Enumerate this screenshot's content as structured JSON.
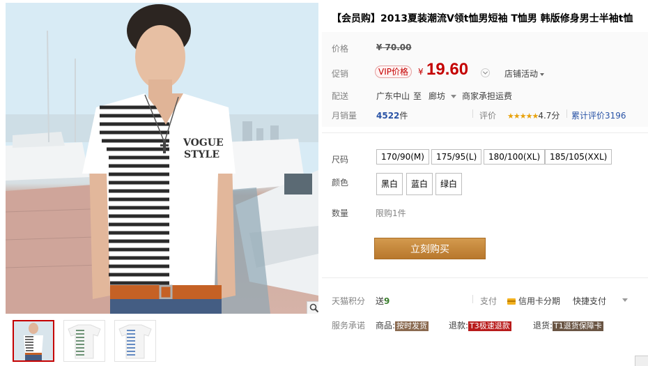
{
  "product": {
    "title": "【会员购】2013夏装潮流V领t恤男短袖 T恤男 韩版修身男士半袖t恤",
    "shirt_print": {
      "line1": "VOGUE",
      "line2": "STYLE"
    }
  },
  "meta": {
    "original_price_label": "价格",
    "original_price": "¥ 70.00",
    "promo_label": "促销",
    "vip_badge": "VIP价格",
    "currency": "¥",
    "price": "19.60",
    "shop_activity": "店铺活动",
    "shipping_label": "配送",
    "ship_from": "广东中山",
    "ship_to_word": "至",
    "ship_dest": "廊坊",
    "shipping_note": "商家承担运费",
    "monthly_sales_label": "月销量",
    "monthly_sales_value": "4522",
    "monthly_sales_unit": "件",
    "rating_label": "评价",
    "rating_stars": "★★★★★",
    "rating_score": "4.7分",
    "total_reviews_label": "累计评价",
    "total_reviews": "3196"
  },
  "options": {
    "size_label": "尺码",
    "sizes": [
      "170/90(M)",
      "175/95(L)",
      "180/100(XL)",
      "185/105(XXL)"
    ],
    "color_label": "颜色",
    "colors": [
      "黑白",
      "蓝白",
      "绿白"
    ],
    "quantity_label": "数量",
    "quantity_limit": "限购1件"
  },
  "actions": {
    "buy_now": "立刻购买"
  },
  "extra": {
    "points_label": "天猫积分",
    "points_prefix": "送",
    "points_value": "9",
    "payment_label": "支付",
    "credit_installment": "信用卡分期",
    "quick_pay": "快捷支付",
    "service_label": "服务承诺",
    "goods_label": "商品:",
    "goods_tag": "按时发货",
    "refund_label": "退款:",
    "refund_tag": "T3极速退款",
    "return_label": "退货:",
    "return_tag": "T1退货保障卡"
  },
  "colors": {
    "price_red": "#c40000",
    "buy_button": "#c5863a",
    "link_blue": "#2953a6",
    "star_gold": "#e8a20c"
  }
}
